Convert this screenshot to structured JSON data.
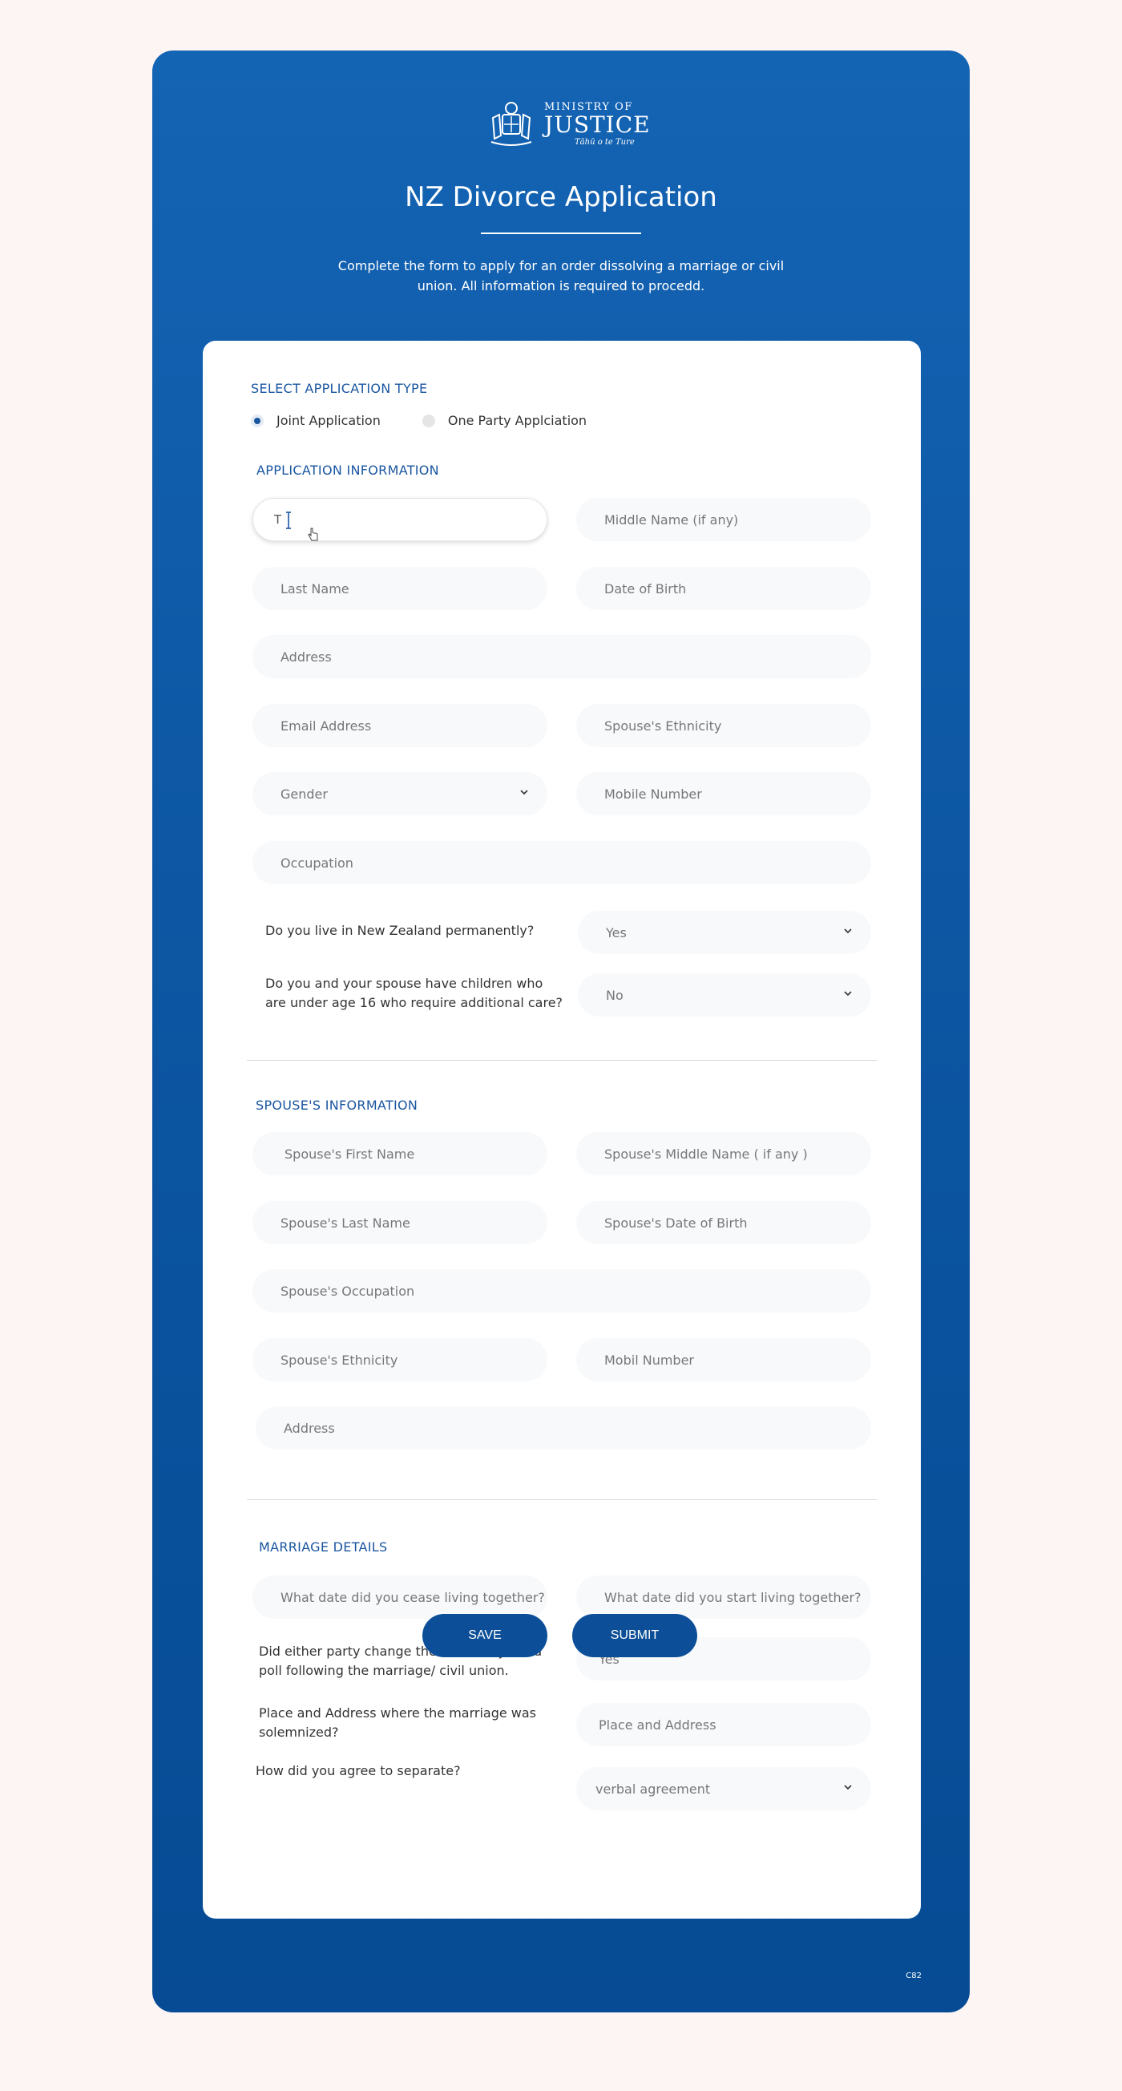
{
  "header": {
    "logo_small": "MINISTRY OF",
    "logo_big": "JUSTICE",
    "logo_tag": "Tāhū o te Ture",
    "title": "NZ Divorce Application",
    "description": "Complete the form to apply for an order dissolving a marriage or civil union. All information is required to procedd."
  },
  "application_type": {
    "label": "SELECT APPLICATION TYPE",
    "options": [
      "Joint Application",
      "One Party Applciation"
    ],
    "selected": "Joint Application"
  },
  "application_info": {
    "label": "APPLICATION INFORMATION",
    "first_name_value": "T",
    "middle_name": "Middle Name (if any)",
    "last_name": "Last Name",
    "dob": "Date of Birth",
    "address": "Address",
    "email": "Email Address",
    "ethnicity": "Spouse's Ethnicity",
    "gender": "Gender",
    "mobile": "Mobile Number",
    "occupation": "Occupation",
    "q_live_nz": "Do you live in New Zealand permanently?",
    "q_live_nz_value": "Yes",
    "q_children": "Do you and your spouse have children who are under age 16 who require additional care?",
    "q_children_value": "No"
  },
  "spouse_info": {
    "label": "SPOUSE'S INFORMATION",
    "first_name": "Spouse's First Name",
    "middle_name": "Spouse's Middle Name ( if any )",
    "last_name": "Spouse's Last Name",
    "dob": "Spouse's Date of Birth",
    "occupation": "Spouse's Occupation",
    "ethnicity": "Spouse's Ethnicity",
    "mobile": "Mobil Number",
    "address": "Address"
  },
  "marriage_details": {
    "label": "MARRIAGE DETAILS",
    "cease_date": "What date did you cease living together?",
    "start_date": "What date did you start living together?",
    "q_name_change": "Did either party change their name by deed poll following the marriage/ civil union.",
    "q_name_change_value": "Yes",
    "q_place": "Place and Address where the marriage was solemnized?",
    "q_place_value": "Place and Address",
    "q_separate": "How did you agree to separate?",
    "q_separate_value": "verbal agreement"
  },
  "buttons": {
    "save": "SAVE",
    "submit": "SUBMIT"
  },
  "footer": {
    "code": "C82"
  },
  "colors": {
    "primary": "#0c4f98",
    "accent_text": "#1a56a0",
    "background": "#fdf4f4"
  }
}
